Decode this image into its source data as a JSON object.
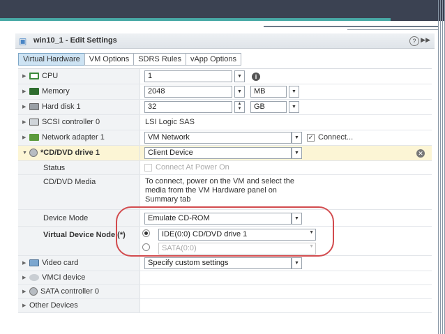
{
  "window": {
    "title": "win10_1 - Edit Settings"
  },
  "tabs": [
    {
      "label": "Virtual Hardware"
    },
    {
      "label": "VM Options"
    },
    {
      "label": "SDRS Rules"
    },
    {
      "label": "vApp Options"
    }
  ],
  "hardware": {
    "cpu": {
      "label": "CPU",
      "value": "1"
    },
    "memory": {
      "label": "Memory",
      "value": "2048",
      "unit": "MB"
    },
    "hard_disk": {
      "label": "Hard disk 1",
      "value": "32",
      "unit": "GB"
    },
    "scsi": {
      "label": "SCSI controller 0",
      "value": "LSI Logic SAS"
    },
    "network": {
      "label": "Network adapter 1",
      "value": "VM Network",
      "connect_label": "Connect..."
    },
    "cdrom": {
      "label": "*CD/DVD drive 1",
      "value": "Client Device",
      "status_label": "Status",
      "status_option": "Connect At Power On",
      "media_label": "CD/DVD Media",
      "media_text": "To connect, power on the VM and select the media from the VM Hardware panel on Summary tab",
      "device_mode_label": "Device Mode",
      "device_mode_value": "Emulate CD-ROM",
      "vdn_label": "Virtual Device Node (*)",
      "vdn_ide": "IDE(0:0) CD/DVD drive 1",
      "vdn_sata": "SATA(0:0)"
    },
    "video": {
      "label": "Video card",
      "value": "Specify custom settings"
    },
    "vmci": {
      "label": "VMCI device"
    },
    "sata": {
      "label": "SATA controller 0"
    },
    "other": {
      "label": "Other Devices"
    }
  },
  "colors": {
    "accent_teal": "#48a9a6",
    "header_dark": "#3b4252",
    "highlight_red": "#d24b4e",
    "selected_row": "#fcf5d5",
    "active_tab": "#cde3f3"
  }
}
